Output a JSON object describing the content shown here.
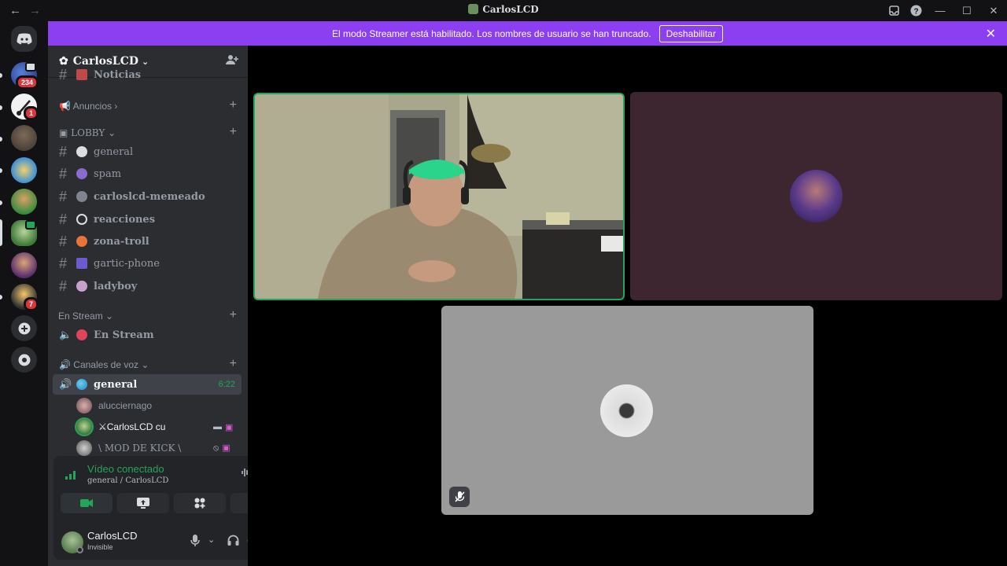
{
  "window": {
    "title": "CarlosLCD",
    "nav_back": "←",
    "nav_forward": "→",
    "buttons": [
      "inbox",
      "help",
      "minimize",
      "maximize",
      "close"
    ]
  },
  "guilds": {
    "badges": {
      "g1": "234",
      "g2": "1",
      "g8": "7"
    }
  },
  "banner": {
    "text": "El modo Streamer está habilitado. Los nombres de usuario se han truncado.",
    "button": "Deshabilitar"
  },
  "server": {
    "name": "CarlosLCD",
    "partial_channel": "Noticias",
    "categories": {
      "anuncios": "Anuncios",
      "lobby": "LOBBY",
      "enstream": "En Stream",
      "voz": "Canales de voz"
    },
    "channels": [
      {
        "name": "general"
      },
      {
        "name": "spam"
      },
      {
        "name": "carloslcd-memeado"
      },
      {
        "name": "reacciones"
      },
      {
        "name": "zona-troll"
      },
      {
        "name": "gartic-phone"
      },
      {
        "name": "ladyboy"
      }
    ],
    "stream_channel": "En Stream",
    "voice_channel": {
      "name": "general",
      "time": "6:22"
    },
    "voice_users": [
      {
        "name": "alucciernago"
      },
      {
        "name": "⚔CarlosLCD cu"
      },
      {
        "name": "\\ MOD DE KICK \\"
      }
    ]
  },
  "voice_panel": {
    "status": "Vídeo conectado",
    "location": "general / CarlosLCD",
    "user": "CarlosLCD",
    "user_status": "Invisible"
  },
  "colors": {
    "accent_green": "#23a55a",
    "banner_purple": "#8b3ff0",
    "badge_red": "#da373c"
  }
}
